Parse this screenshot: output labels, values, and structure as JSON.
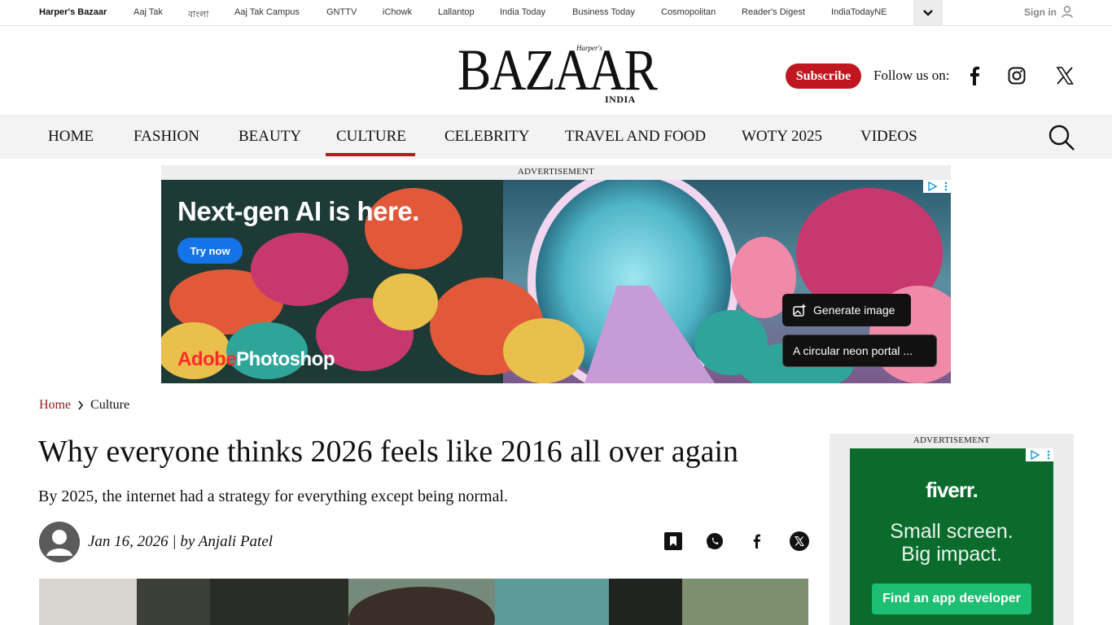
{
  "network_bar": {
    "links": [
      "Harper's Bazaar",
      "Aaj Tak",
      "বাংলা",
      "Aaj Tak Campus",
      "GNTTV",
      "iChowk",
      "Lallantop",
      "India Today",
      "Business Today",
      "Cosmopolitan",
      "Reader's Digest",
      "IndiaTodayNE"
    ],
    "signin_label": "Sign in"
  },
  "masthead": {
    "logo_text": "BAZAAR",
    "logo_small": "Harper's",
    "logo_sub": "INDIA",
    "subscribe_label": "Subscribe",
    "follow_label": "Follow us on:"
  },
  "nav": {
    "items": [
      "HOME",
      "FASHION",
      "BEAUTY",
      "CULTURE",
      "CELEBRITY",
      "TRAVEL AND FOOD",
      "WOTY 2025",
      "VIDEOS"
    ],
    "active": "CULTURE"
  },
  "ad_top": {
    "label": "ADVERTISEMENT",
    "headline": "Next-gen AI is here.",
    "cta": "Try now",
    "brand_part1": "Adobe",
    "brand_part2": "Photoshop",
    "generate_label": "Generate image",
    "prompt_text": "A circular neon portal ..."
  },
  "breadcrumb": {
    "home": "Home",
    "current": "Culture"
  },
  "article": {
    "title": "Why everyone thinks 2026 feels like 2016 all over again",
    "dek": "By 2025, the internet had a strategy for everything except being normal.",
    "byline": "Jan 16, 2026 | by Anjali Patel"
  },
  "ad_side": {
    "label": "ADVERTISEMENT",
    "brand": "fiverr.",
    "line1": "Small screen.",
    "line2": "Big impact.",
    "cta": "Find an app developer"
  },
  "colors": {
    "brand_red": "#c0161f",
    "breadcrumb_link": "#8c1c1c",
    "fiverr_green": "#1dbf73"
  }
}
